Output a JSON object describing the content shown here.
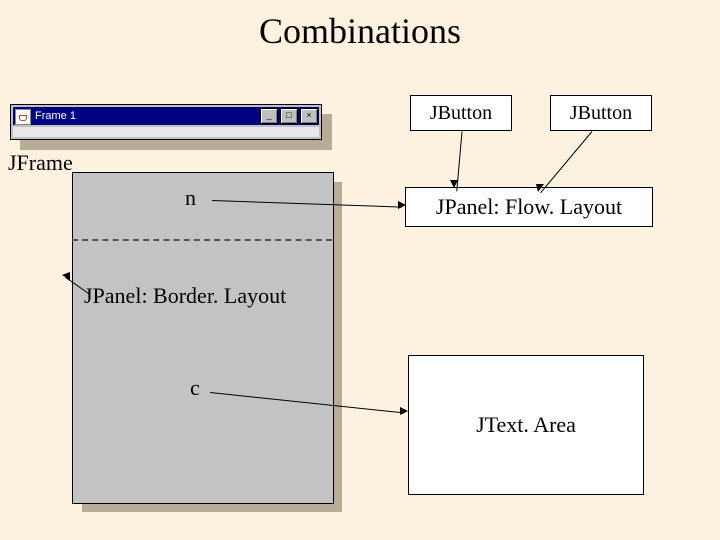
{
  "title": "Combinations",
  "window": {
    "title": "Frame 1",
    "min": "_",
    "max": "□",
    "close": "×"
  },
  "labels": {
    "jframe": "JFrame",
    "n": "n",
    "c": "c",
    "borderlayout": "JPanel:  Border. Layout",
    "jbutton1": "JButton",
    "jbutton2": "JButton",
    "flowlayout": "JPanel:  Flow. Layout",
    "textarea": "JText. Area"
  }
}
